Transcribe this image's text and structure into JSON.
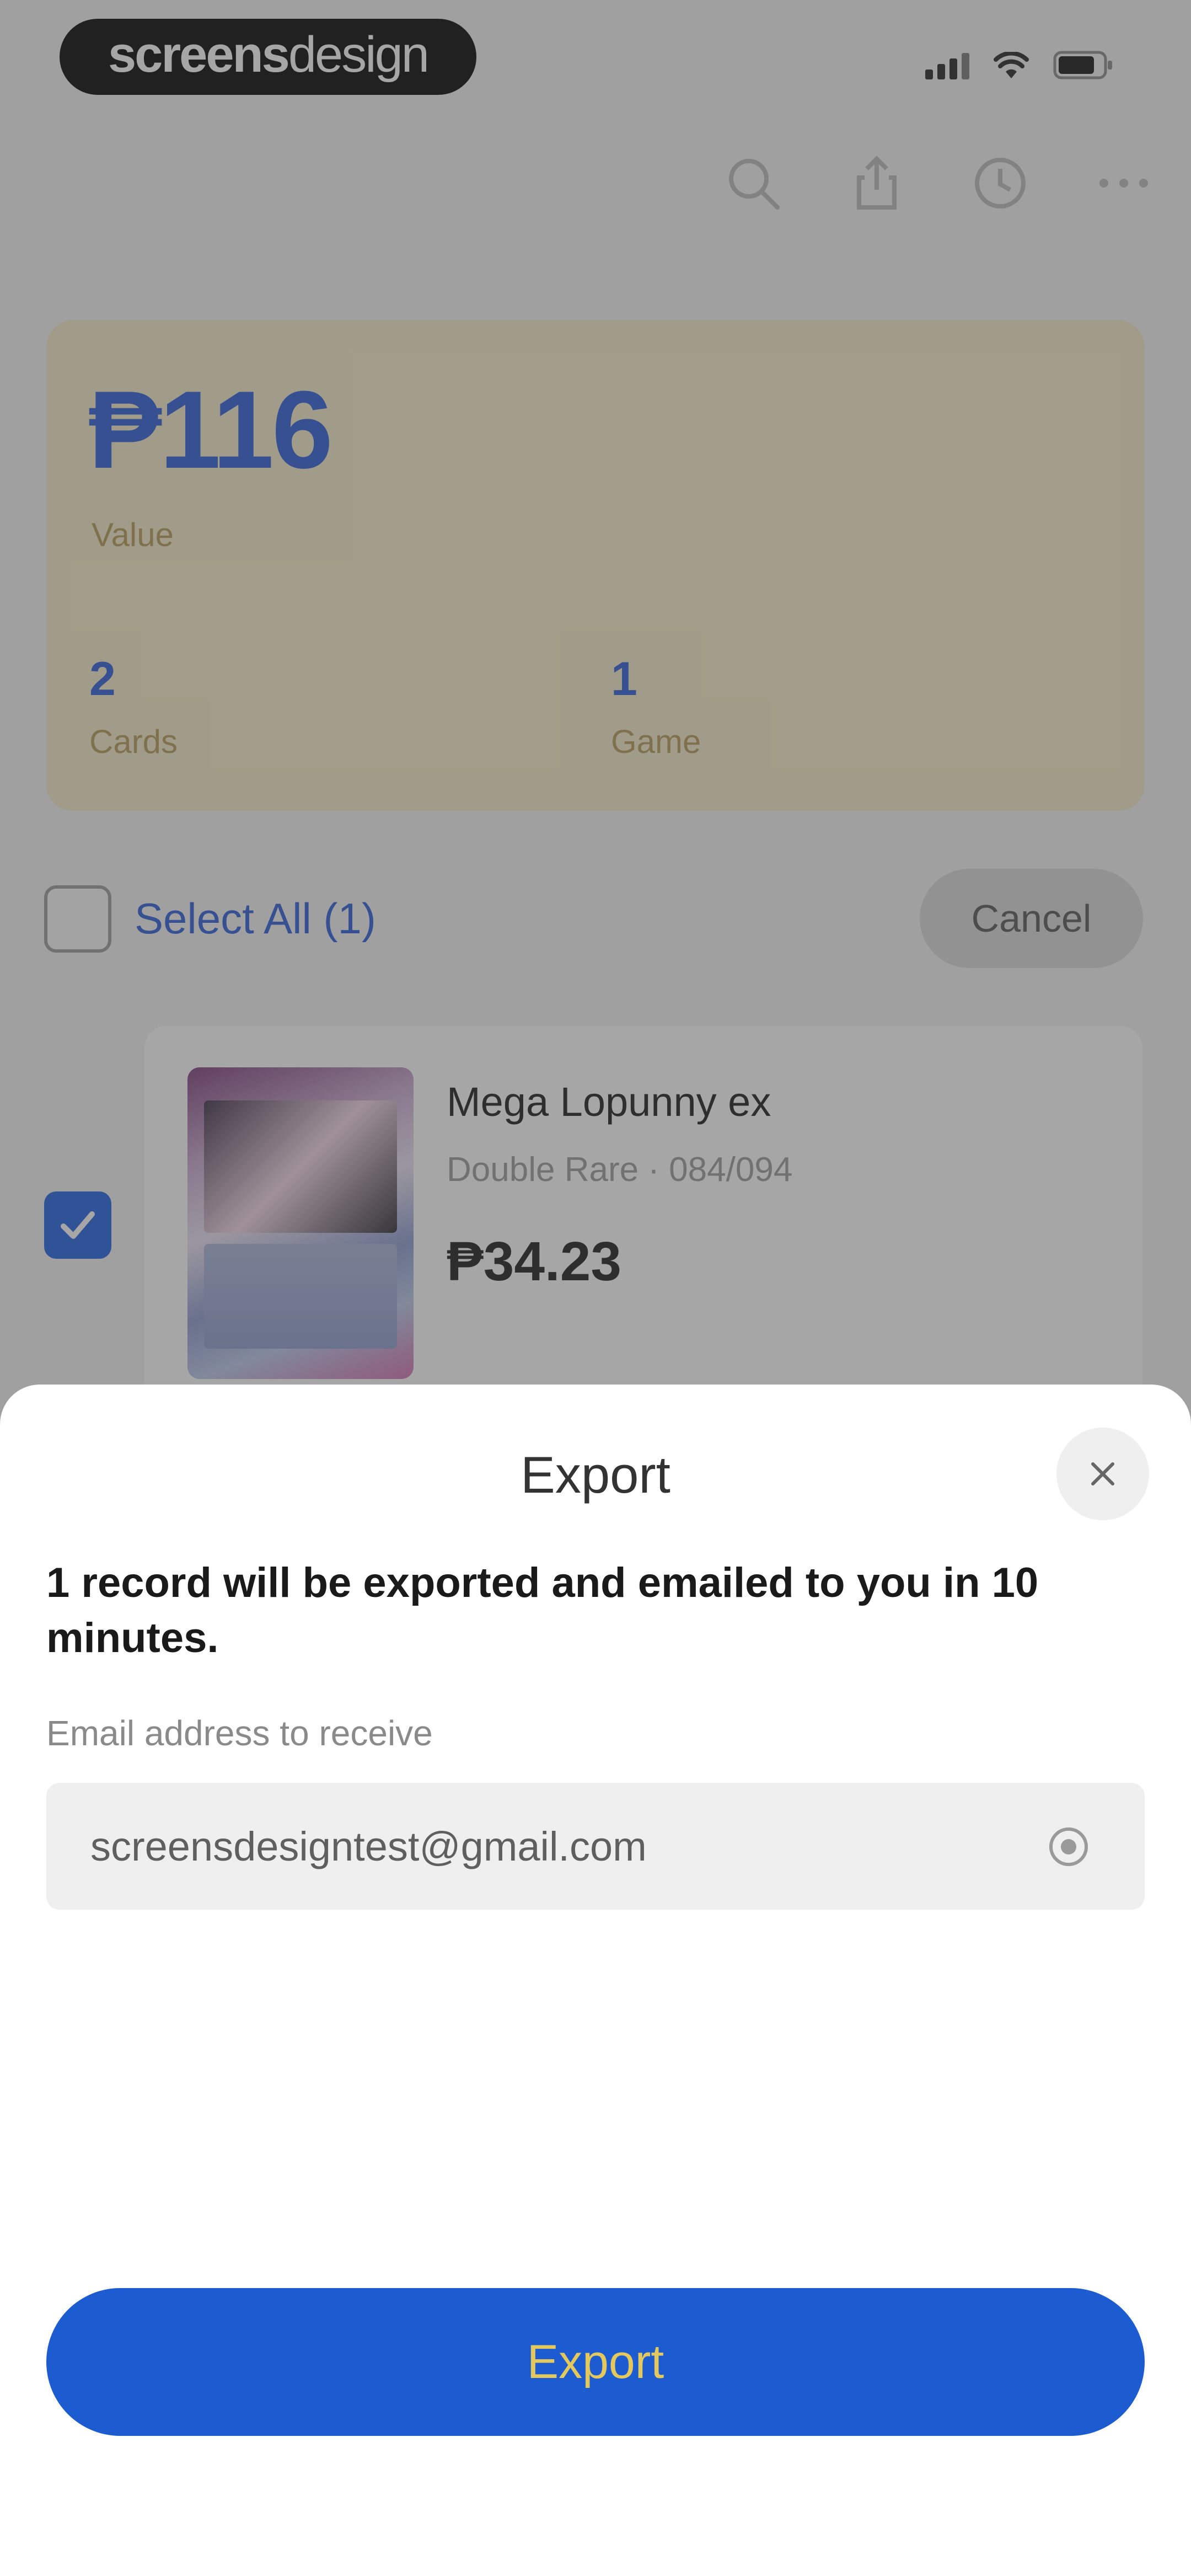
{
  "status_bar": {
    "brand_bold": "screens",
    "brand_light": "design"
  },
  "toolbar": {
    "icons": [
      "search-icon",
      "share-icon",
      "history-icon",
      "more-icon"
    ]
  },
  "summary": {
    "value": "₱116",
    "value_label": "Value",
    "cards_count": "2",
    "cards_label": "Cards",
    "game_count": "1",
    "game_label": "Game"
  },
  "selection": {
    "select_all_label": "Select All (1)",
    "cancel_label": "Cancel"
  },
  "card_item": {
    "name": "Mega Lopunny ex",
    "subtitle": "Double Rare · 084/094",
    "price": "₱34.23",
    "checked": true
  },
  "export_sheet": {
    "title": "Export",
    "message": "1 record will be exported and emailed to you in 10 minutes.",
    "email_label": "Email address to receive",
    "email_value": "screensdesigntest@gmail.com",
    "export_button_label": "Export"
  },
  "colors": {
    "accent": "#1d5bd0",
    "summary_card_bg": "#f5ecc7",
    "export_button_text": "#e3c85e"
  }
}
